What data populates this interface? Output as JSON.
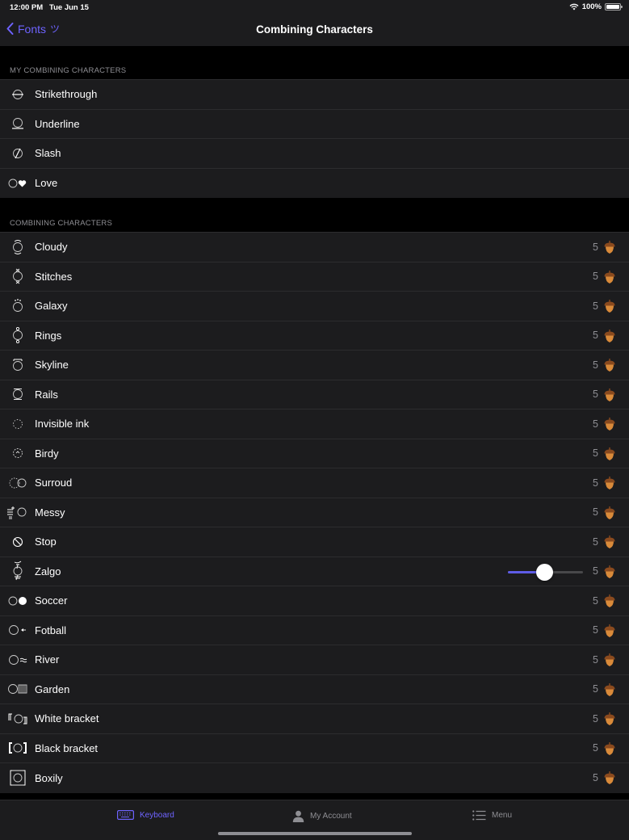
{
  "status_bar": {
    "time": "12:00 PM",
    "date": "Tue Jun 15",
    "battery": "100%"
  },
  "nav": {
    "back_label": "Fonts",
    "back_deco": "ツ",
    "title": "Combining Characters"
  },
  "my_section": {
    "header": "MY COMBINING CHARACTERS",
    "items": [
      {
        "label": "Strikethrough",
        "icon": "strikethrough-icon"
      },
      {
        "label": "Underline",
        "icon": "underline-icon"
      },
      {
        "label": "Slash",
        "icon": "slash-icon"
      },
      {
        "label": "Love",
        "icon": "love-icon"
      }
    ]
  },
  "all_section": {
    "header": "COMBINING CHARACTERS",
    "items": [
      {
        "label": "Cloudy",
        "cost": "5",
        "icon": "cloudy-icon"
      },
      {
        "label": "Stitches",
        "cost": "5",
        "icon": "stitches-icon"
      },
      {
        "label": "Galaxy",
        "cost": "5",
        "icon": "galaxy-icon"
      },
      {
        "label": "Rings",
        "cost": "5",
        "icon": "rings-icon"
      },
      {
        "label": "Skyline",
        "cost": "5",
        "icon": "skyline-icon"
      },
      {
        "label": "Rails",
        "cost": "5",
        "icon": "rails-icon"
      },
      {
        "label": "Invisible ink",
        "cost": "5",
        "icon": "invisible-ink-icon"
      },
      {
        "label": "Birdy",
        "cost": "5",
        "icon": "birdy-icon"
      },
      {
        "label": "Surroud",
        "cost": "5",
        "icon": "surround-icon"
      },
      {
        "label": "Messy",
        "cost": "5",
        "icon": "messy-icon"
      },
      {
        "label": "Stop",
        "cost": "5",
        "icon": "stop-icon"
      },
      {
        "label": "Zalgo",
        "cost": "5",
        "icon": "zalgo-icon"
      },
      {
        "label": "Soccer",
        "cost": "5",
        "icon": "soccer-icon"
      },
      {
        "label": "Fotball",
        "cost": "5",
        "icon": "football-icon"
      },
      {
        "label": "River",
        "cost": "5",
        "icon": "river-icon"
      },
      {
        "label": "Garden",
        "cost": "5",
        "icon": "garden-icon"
      },
      {
        "label": "White bracket",
        "cost": "5",
        "icon": "white-bracket-icon"
      },
      {
        "label": "Black bracket",
        "cost": "5",
        "icon": "black-bracket-icon"
      },
      {
        "label": "Boxily",
        "cost": "5",
        "icon": "boxily-icon"
      }
    ]
  },
  "zalgo_slider": {
    "value_fraction": 0.48
  },
  "tabs": [
    {
      "label": "Keyboard",
      "icon": "keyboard-icon",
      "active": true
    },
    {
      "label": "My Account",
      "icon": "person-icon",
      "active": false
    },
    {
      "label": "Menu",
      "icon": "menu-icon",
      "active": false
    }
  ],
  "colors": {
    "accent": "#6e63ff",
    "slider_fill": "#5e5ce6",
    "acorn": "#c8762e",
    "background": "#000000",
    "cell": "#1c1c1e"
  }
}
